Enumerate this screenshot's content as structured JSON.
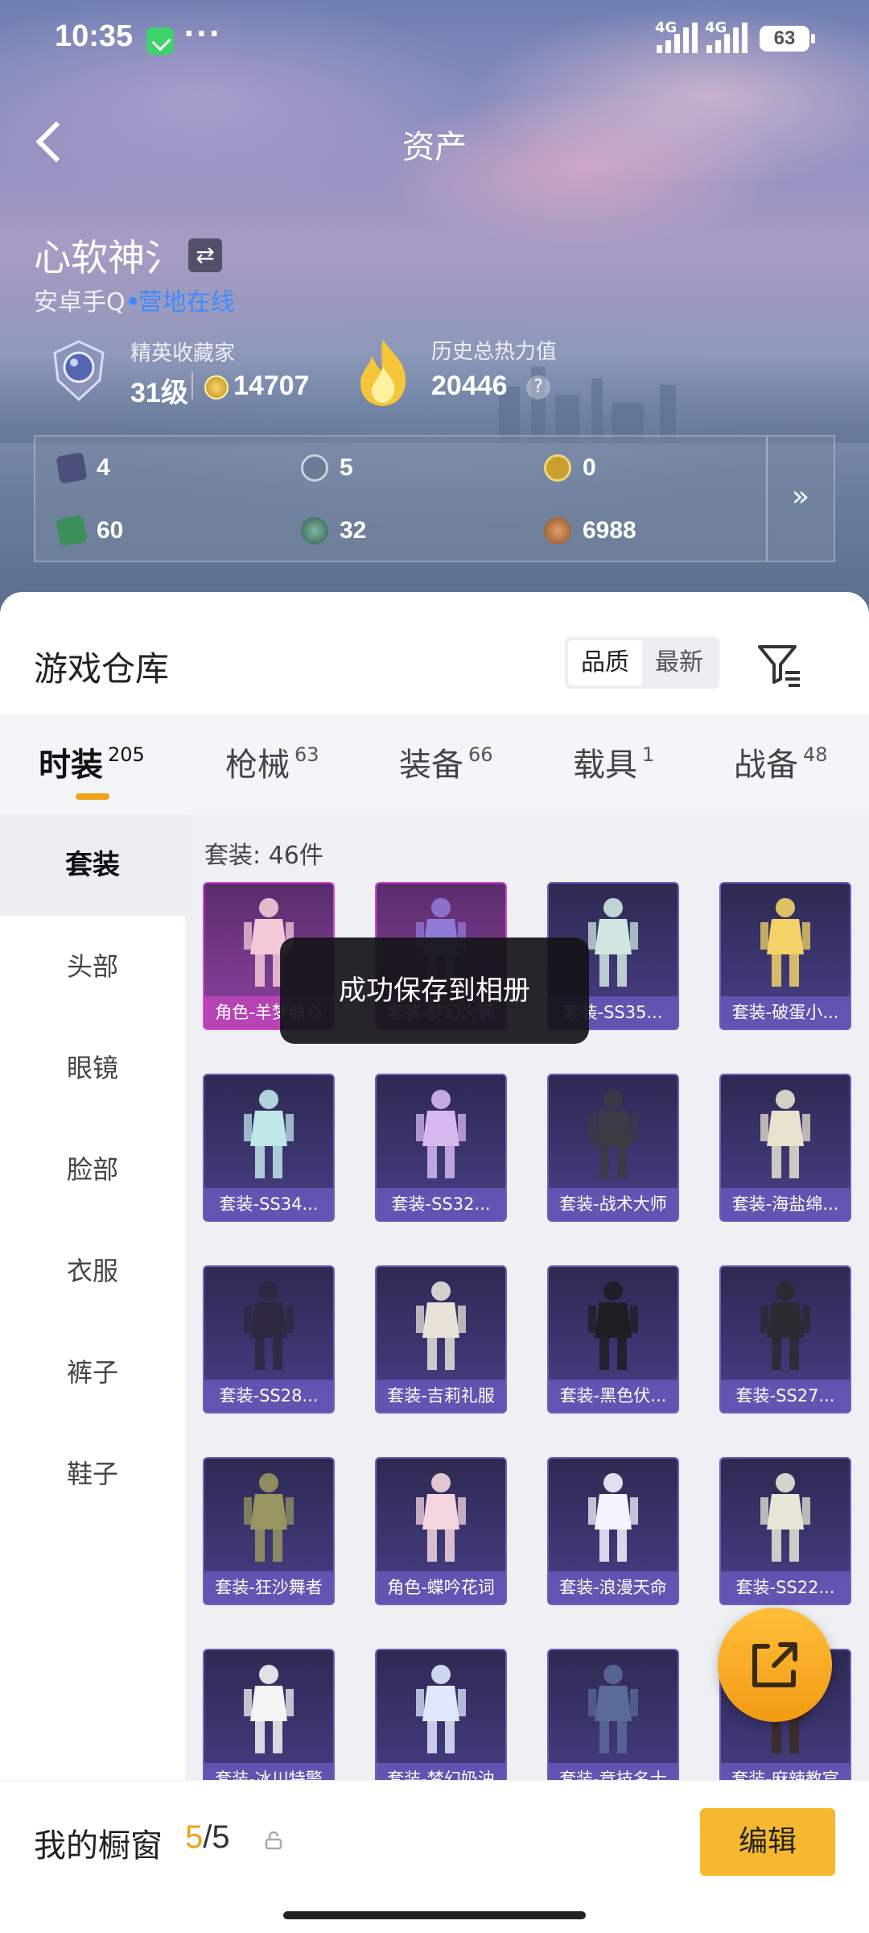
{
  "status_bar": {
    "time": "10:35",
    "more": "···",
    "network1": "4G",
    "network2": "4G",
    "battery": "63"
  },
  "header": {
    "title": "资产"
  },
  "profile": {
    "username": "心软神氵",
    "platform_prefix": "安卓手Q",
    "online_status": "营地在线",
    "collector_label": "精英收藏家",
    "collector_level": "31级",
    "collector_points": "14707",
    "heat_label": "历史总热力值",
    "heat_value": "20446",
    "help": "?"
  },
  "resources": [
    {
      "icon": "card-ticket-icon",
      "value": "4",
      "color": "#4b4f7a"
    },
    {
      "icon": "silver-coin-icon",
      "value": "5",
      "color": "#6b7a95"
    },
    {
      "icon": "gold-token-icon",
      "value": "0",
      "color": "#c9a02e"
    },
    {
      "icon": "green-voucher-icon",
      "value": "60",
      "color": "#3b8f5a"
    },
    {
      "icon": "green-orb-icon",
      "value": "32",
      "color": "#3f6d5f"
    },
    {
      "icon": "bronze-token-icon",
      "value": "6988",
      "color": "#b0703a"
    }
  ],
  "resources_more": "»",
  "warehouse": {
    "title": "游戏仓库",
    "sort_options": [
      "品质",
      "最新"
    ],
    "active_sort": "品质"
  },
  "tabs": [
    {
      "label": "时装",
      "count": "205"
    },
    {
      "label": "枪械",
      "count": "63"
    },
    {
      "label": "装备",
      "count": "66"
    },
    {
      "label": "载具",
      "count": "1"
    },
    {
      "label": "战备",
      "count": "48"
    }
  ],
  "sidebar": [
    "套装",
    "头部",
    "眼镜",
    "脸部",
    "衣服",
    "裤子",
    "鞋子"
  ],
  "grid": {
    "count_label": "套装: 46件",
    "items": [
      "角色-羊梦糖心",
      "套装-梦幻火箭",
      "套装-SS35...",
      "套装-破蛋小...",
      "套装-SS34...",
      "套装-SS32...",
      "套装-战术大师",
      "套装-海盐绵...",
      "套装-SS28...",
      "套装-吉莉礼服",
      "套装-黑色伏...",
      "套装-SS27...",
      "套装-狂沙舞者",
      "角色-蝶吟花词",
      "套装-浪漫天命",
      "套装-SS22...",
      "套装-冰川特警",
      "套装-梦幻奶油",
      "套装-竞技名士",
      "套装-麻辣教官"
    ]
  },
  "toast": "成功保存到相册",
  "showcase": {
    "label": "我的橱窗",
    "current": "5",
    "total": "/5",
    "edit": "编辑"
  },
  "colors": {
    "accent": "#f0a21a",
    "online": "#3e8bff",
    "card": "#3b3570"
  }
}
